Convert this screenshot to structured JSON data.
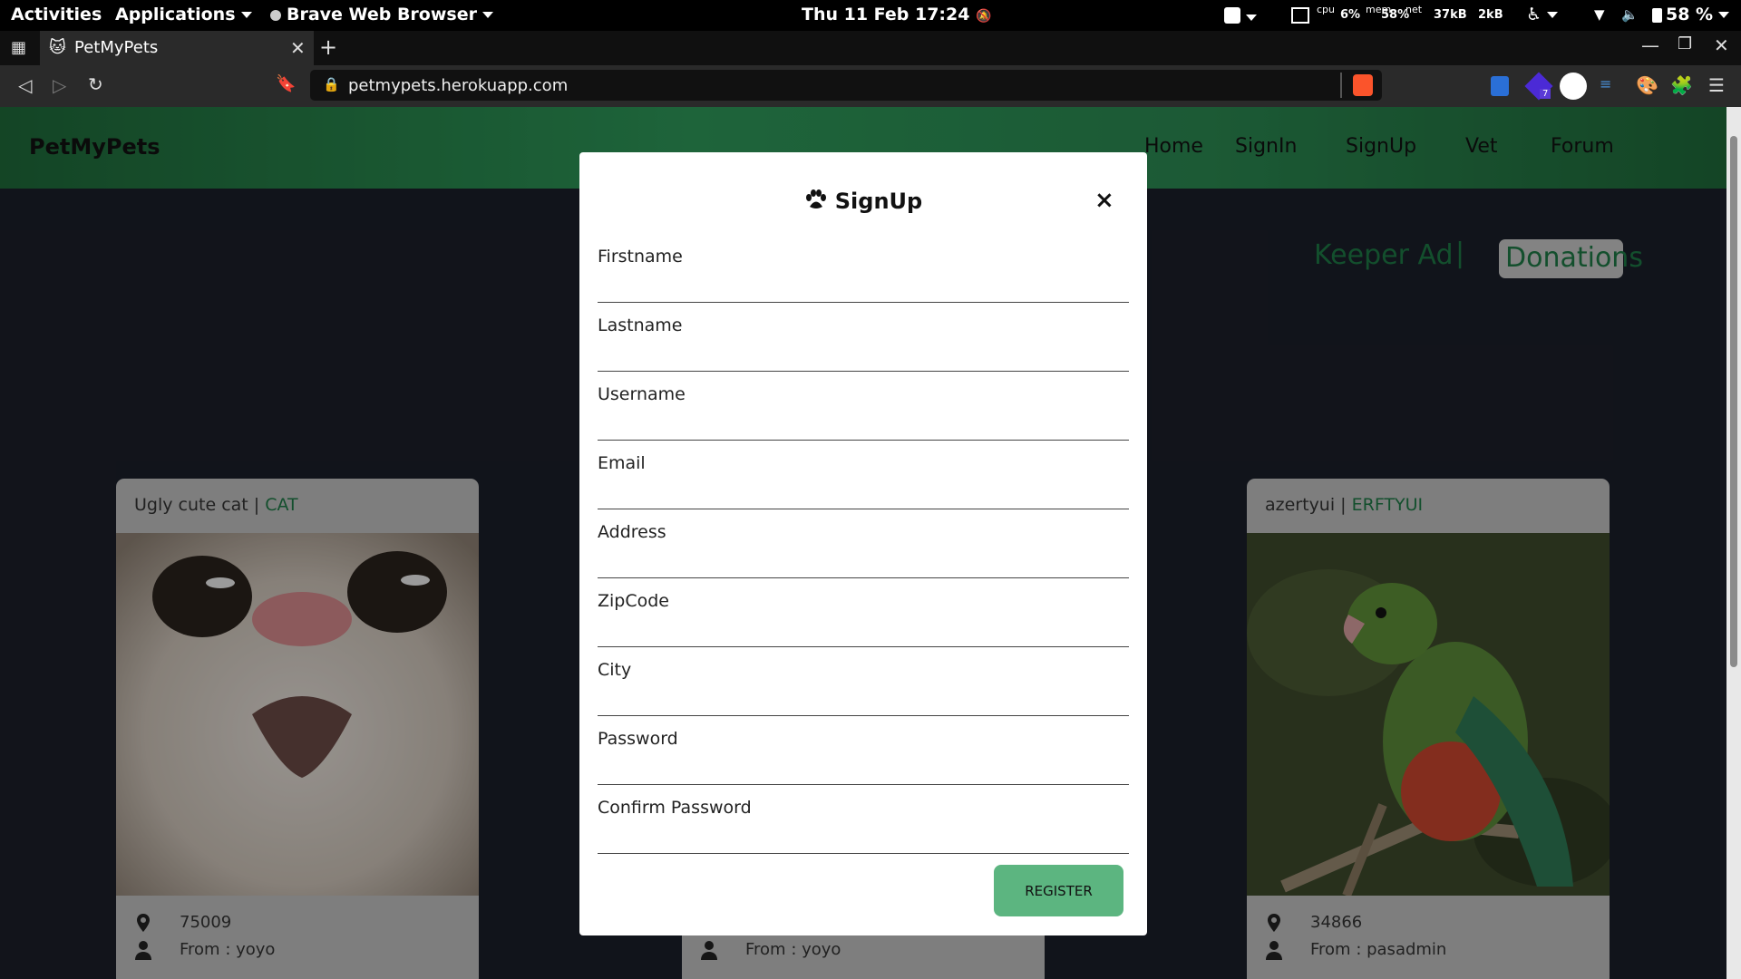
{
  "system_bar": {
    "activities": "Activities",
    "applications": "Applications",
    "app_name": "Brave Web Browser",
    "datetime": "Thu 11 Feb  17:24",
    "cpu_label": "cpu",
    "cpu_value": "6%",
    "mem_label": "mem",
    "mem_value": "58%",
    "net_label": "net",
    "net_down": "37kB",
    "net_up": "2kB",
    "battery": "58 %"
  },
  "browser": {
    "tab_title": "PetMyPets",
    "url": "petmypets.herokuapp.com",
    "extension_badge": "7"
  },
  "site": {
    "brand": "PetMyPets",
    "nav": [
      "Home",
      "SignIn",
      "SignUp",
      "Vet",
      "Forum"
    ],
    "subnav_keeper": "Keeper Ad",
    "subnav_sep": "|",
    "subnav_donations": "Donations"
  },
  "cards": [
    {
      "name": "Ugly cute cat",
      "sep": " | ",
      "category": "CAT",
      "zip": "75009",
      "from": "From : yoyo"
    },
    {
      "from": "From : yoyo"
    },
    {
      "name": "azertyui",
      "sep": " | ",
      "category": "ERFTYUI",
      "zip": "34866",
      "from": "From : pasadmin"
    }
  ],
  "modal": {
    "title": "SignUp",
    "close": "×",
    "fields": [
      "Firstname",
      "Lastname",
      "Username",
      "Email",
      "Address",
      "ZipCode",
      "City",
      "Password",
      "Confirm Password"
    ],
    "submit": "REGISTER"
  },
  "colors": {
    "accent_green": "#1e7a46",
    "button_green": "#5cb580"
  }
}
